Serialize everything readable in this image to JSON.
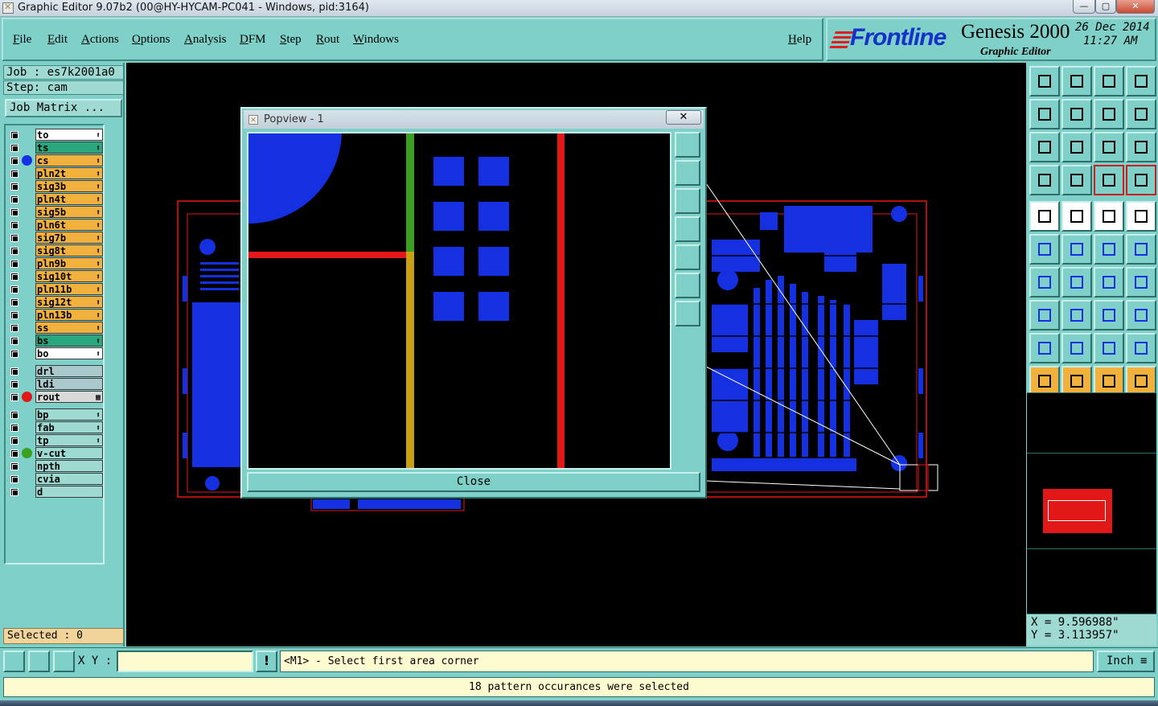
{
  "window": {
    "title": "Graphic Editor 9.07b2 (00@HY-HYCAM-PC041 - Windows, pid:3164)",
    "min": "—",
    "max": "▢",
    "close": "✕"
  },
  "menu": [
    "File",
    "Edit",
    "Actions",
    "Options",
    "Analysis",
    "DFM",
    "Step",
    "Rout",
    "Windows"
  ],
  "help_label": "Help",
  "brand": {
    "logo": "Frontline",
    "product": "Genesis 2000",
    "subtitle": "Graphic Editor",
    "date": "26 Dec 2014",
    "time": "11:27 AM"
  },
  "job": {
    "job_line": "Job : es7k2001a0",
    "step_line": "Step: cam",
    "matrix_label": "Job Matrix ..."
  },
  "layers": [
    {
      "name": "to",
      "color": "#ffffff",
      "dot": "",
      "end": "⬆"
    },
    {
      "name": "ts",
      "color": "#2aa77d",
      "dot": "",
      "end": "⬆"
    },
    {
      "name": "cs",
      "color": "#f2b13c",
      "dot": "#1530e0",
      "end": "⬆"
    },
    {
      "name": "pln2t",
      "color": "#f2b13c",
      "dot": "",
      "end": "⬆"
    },
    {
      "name": "sig3b",
      "color": "#f2b13c",
      "dot": "",
      "end": "⬆"
    },
    {
      "name": "pln4t",
      "color": "#f2b13c",
      "dot": "",
      "end": "⬆"
    },
    {
      "name": "sig5b",
      "color": "#f2b13c",
      "dot": "",
      "end": "⬆"
    },
    {
      "name": "pln6t",
      "color": "#f2b13c",
      "dot": "",
      "end": "⬆"
    },
    {
      "name": "sig7b",
      "color": "#f2b13c",
      "dot": "",
      "end": "⬆"
    },
    {
      "name": "sig8t",
      "color": "#f2b13c",
      "dot": "",
      "end": "⬆"
    },
    {
      "name": "pln9b",
      "color": "#f2b13c",
      "dot": "",
      "end": "⬆"
    },
    {
      "name": "sig10t",
      "color": "#f2b13c",
      "dot": "",
      "end": "⬆"
    },
    {
      "name": "pln11b",
      "color": "#f2b13c",
      "dot": "",
      "end": "⬆"
    },
    {
      "name": "sig12t",
      "color": "#f2b13c",
      "dot": "",
      "end": "⬆"
    },
    {
      "name": "pln13b",
      "color": "#f2b13c",
      "dot": "",
      "end": "⬆"
    },
    {
      "name": "ss",
      "color": "#f2b13c",
      "dot": "",
      "end": "⬆"
    },
    {
      "name": "bs",
      "color": "#2aa77d",
      "dot": "",
      "end": "⬆"
    },
    {
      "name": "bo",
      "color": "#ffffff",
      "dot": "",
      "end": "⬆"
    },
    {
      "name": "drl",
      "color": "#a9c9cc",
      "dot": "",
      "end": ""
    },
    {
      "name": "ldi",
      "color": "#a9c9cc",
      "dot": "",
      "end": ""
    },
    {
      "name": "rout",
      "color": "#d9d9d9",
      "dot": "#e21818",
      "end": "▦"
    },
    {
      "name": "bp",
      "color": "#9ed9d2",
      "dot": "",
      "end": "⬆"
    },
    {
      "name": "fab",
      "color": "#9ed9d2",
      "dot": "",
      "end": "⬆"
    },
    {
      "name": "tp",
      "color": "#9ed9d2",
      "dot": "",
      "end": "⬆"
    },
    {
      "name": "v-cut",
      "color": "#9ed9d2",
      "dot": "#3aa020",
      "end": ""
    },
    {
      "name": "npth",
      "color": "#9ed9d2",
      "dot": "",
      "end": ""
    },
    {
      "name": "cvia",
      "color": "#9ed9d2",
      "dot": "",
      "end": ""
    },
    {
      "name": "d",
      "color": "#9ed9d2",
      "dot": "",
      "end": ""
    }
  ],
  "selected_label": "Selected : 0",
  "popview": {
    "title": "Popview - 1",
    "close_x": "✕",
    "close_label": "Close"
  },
  "coords": {
    "x": "X = 9.596988\"",
    "y": "Y = 3.113957\""
  },
  "cmd": {
    "xy_label": "X Y :",
    "xy_value": "",
    "prompt": "<M1> - Select first area corner",
    "unit": "Inch"
  },
  "status_message": "18 pattern occurances were selected",
  "colors": {
    "panel": "#7fd0c8",
    "board": "#1530e0",
    "outline": "#e21818",
    "prompt_bg": "#fffbd0"
  }
}
